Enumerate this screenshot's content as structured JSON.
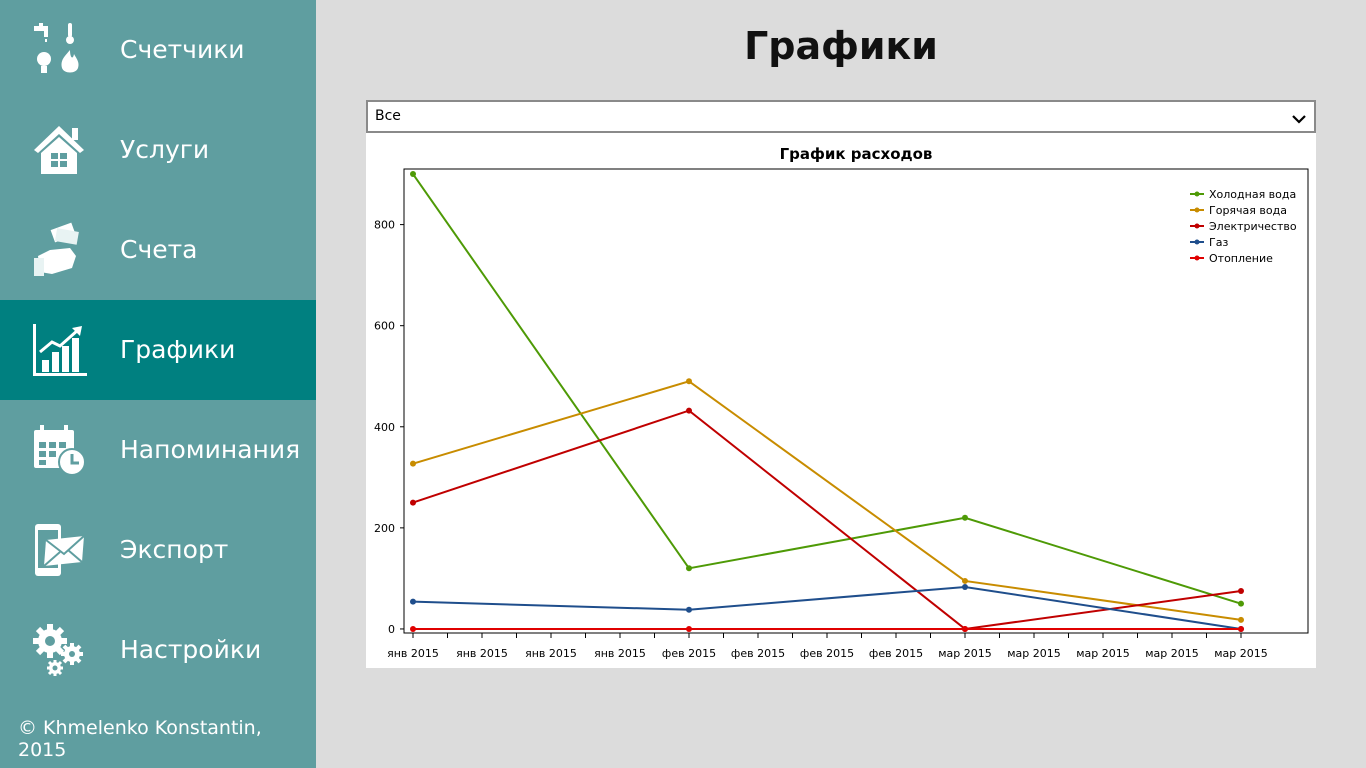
{
  "sidebar": {
    "items": [
      {
        "label": "Счетчики",
        "icon": "meters-icon",
        "active": false
      },
      {
        "label": "Услуги",
        "icon": "house-icon",
        "active": false
      },
      {
        "label": "Счета",
        "icon": "money-hand-icon",
        "active": false
      },
      {
        "label": "Графики",
        "icon": "chart-icon",
        "active": true
      },
      {
        "label": "Напоминания",
        "icon": "calendar-clock-icon",
        "active": false
      },
      {
        "label": "Экспорт",
        "icon": "phone-mail-icon",
        "active": false
      },
      {
        "label": "Настройки",
        "icon": "gears-icon",
        "active": false
      }
    ],
    "copyright": "© Khmelenko Konstantin, 2015"
  },
  "page": {
    "title": "Графики"
  },
  "filter": {
    "value": "Все",
    "icon": "chevron-down-icon"
  },
  "colors": {
    "sidebar": "#5f9ea0",
    "sidebar_active": "#008080",
    "background": "#dcdcdc"
  },
  "chart_data": {
    "type": "line",
    "title": "График расходов",
    "xlabel": "",
    "ylabel": "",
    "x_tick_labels": [
      "янв 2015",
      "янв 2015",
      "янв 2015",
      "янв 2015",
      "фев 2015",
      "фев 2015",
      "фев 2015",
      "фев 2015",
      "мар 2015",
      "мар 2015",
      "мар 2015",
      "мар 2015",
      "мар 2015"
    ],
    "y_ticks": [
      0,
      200,
      400,
      600,
      800
    ],
    "ylim": [
      -8,
      910
    ],
    "x": [
      "янв 2015",
      "фев 2015",
      "мар 2015",
      "мар 2015"
    ],
    "grid": false,
    "legend_position": "top-right",
    "series": [
      {
        "name": "Холодная вода",
        "color": "#4e9a06",
        "values": [
          900,
          120,
          220,
          50
        ]
      },
      {
        "name": "Горячая вода",
        "color": "#c88c00",
        "values": [
          327,
          490,
          95,
          18
        ]
      },
      {
        "name": "Электричество",
        "color": "#c00000",
        "values": [
          250,
          432,
          0,
          75
        ]
      },
      {
        "name": "Газ",
        "color": "#1f4e8c",
        "values": [
          54,
          38,
          83,
          0
        ]
      },
      {
        "name": "Отопление",
        "color": "#e00000",
        "values": [
          0,
          0,
          0,
          0
        ]
      }
    ]
  }
}
